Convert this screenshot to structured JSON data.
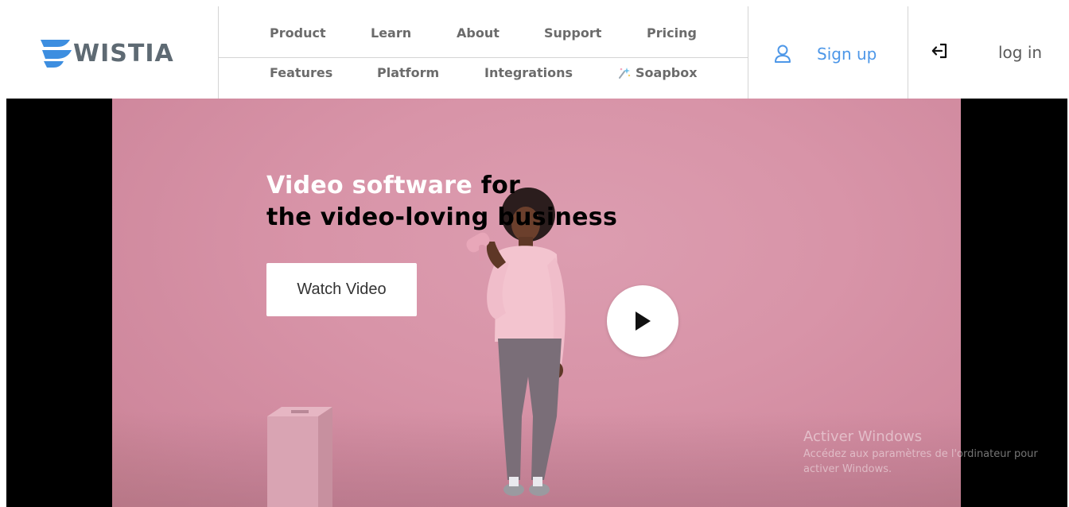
{
  "brand": {
    "name": "WISTIA",
    "accent": "#4d97e8",
    "logo_blue": "#3d8ee0"
  },
  "nav": {
    "top_row": [
      "Product",
      "Learn",
      "About",
      "Support",
      "Pricing"
    ],
    "bottom_row": [
      "Features",
      "Platform",
      "Integrations",
      "Soapbox"
    ],
    "soapbox_icon": "sparkle-icon"
  },
  "account": {
    "signup_label": "Sign up",
    "signup_icon": "user-icon",
    "login_label": "log in",
    "login_icon": "login-arrow-icon"
  },
  "hero": {
    "headline_highlight": "Video software",
    "headline_rest_line1": " for",
    "headline_line2": "the video-loving business",
    "cta_label": "Watch Video",
    "play_icon": "play-icon",
    "background_color": "#d894a8"
  },
  "os_overlay": {
    "title": "Activer Windows",
    "subtitle": "Accédez aux paramètres de l'ordinateur pour activer Windows."
  }
}
